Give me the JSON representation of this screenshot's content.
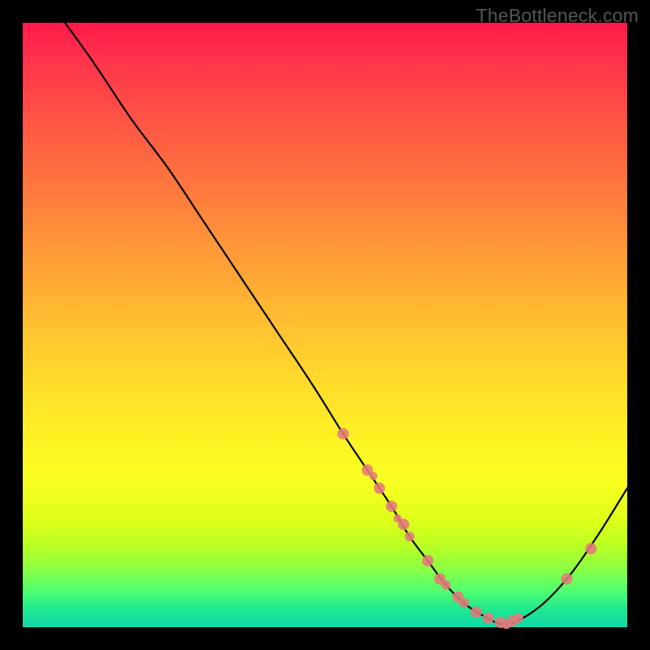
{
  "watermark": "TheBottleneck.com",
  "chart_data": {
    "type": "line",
    "title": "",
    "xlabel": "",
    "ylabel": "",
    "xlim": [
      0,
      100
    ],
    "ylim": [
      0,
      100
    ],
    "x": [
      7,
      12,
      18,
      24,
      30,
      36,
      42,
      48,
      53,
      57,
      61,
      64,
      67,
      70,
      73,
      76,
      80,
      85,
      90,
      95,
      100
    ],
    "values": [
      100,
      93,
      84,
      76,
      67,
      58,
      49,
      40,
      32,
      26,
      20,
      15,
      11,
      7,
      4,
      2,
      0.5,
      3,
      8,
      15,
      23
    ],
    "series": [
      {
        "name": "bottleneck-curve",
        "type": "line",
        "x": [
          7,
          12,
          18,
          24,
          30,
          36,
          42,
          48,
          53,
          57,
          61,
          64,
          67,
          70,
          73,
          76,
          80,
          85,
          90,
          95,
          100
        ],
        "y": [
          100,
          93,
          84,
          76,
          67,
          58,
          49,
          40,
          32,
          26,
          20,
          15,
          11,
          7,
          4,
          2,
          0.5,
          3,
          8,
          15,
          23
        ]
      },
      {
        "name": "data-points",
        "type": "scatter",
        "color": "#e47a7a",
        "x": [
          53,
          57,
          58,
          59,
          61,
          62,
          63,
          64,
          67,
          69,
          70,
          72,
          73,
          75,
          77,
          79,
          80,
          81,
          82,
          90,
          94
        ],
        "y": [
          32,
          26,
          25,
          23,
          20,
          18,
          17,
          15,
          11,
          8,
          7,
          5,
          4,
          2.5,
          1.5,
          0.8,
          0.5,
          1,
          1.5,
          8,
          13
        ],
        "r": [
          7,
          7,
          5,
          7,
          7,
          5,
          7,
          6,
          7,
          7,
          6,
          7,
          6,
          7,
          7,
          7,
          6,
          7,
          6,
          7,
          7
        ]
      }
    ]
  }
}
